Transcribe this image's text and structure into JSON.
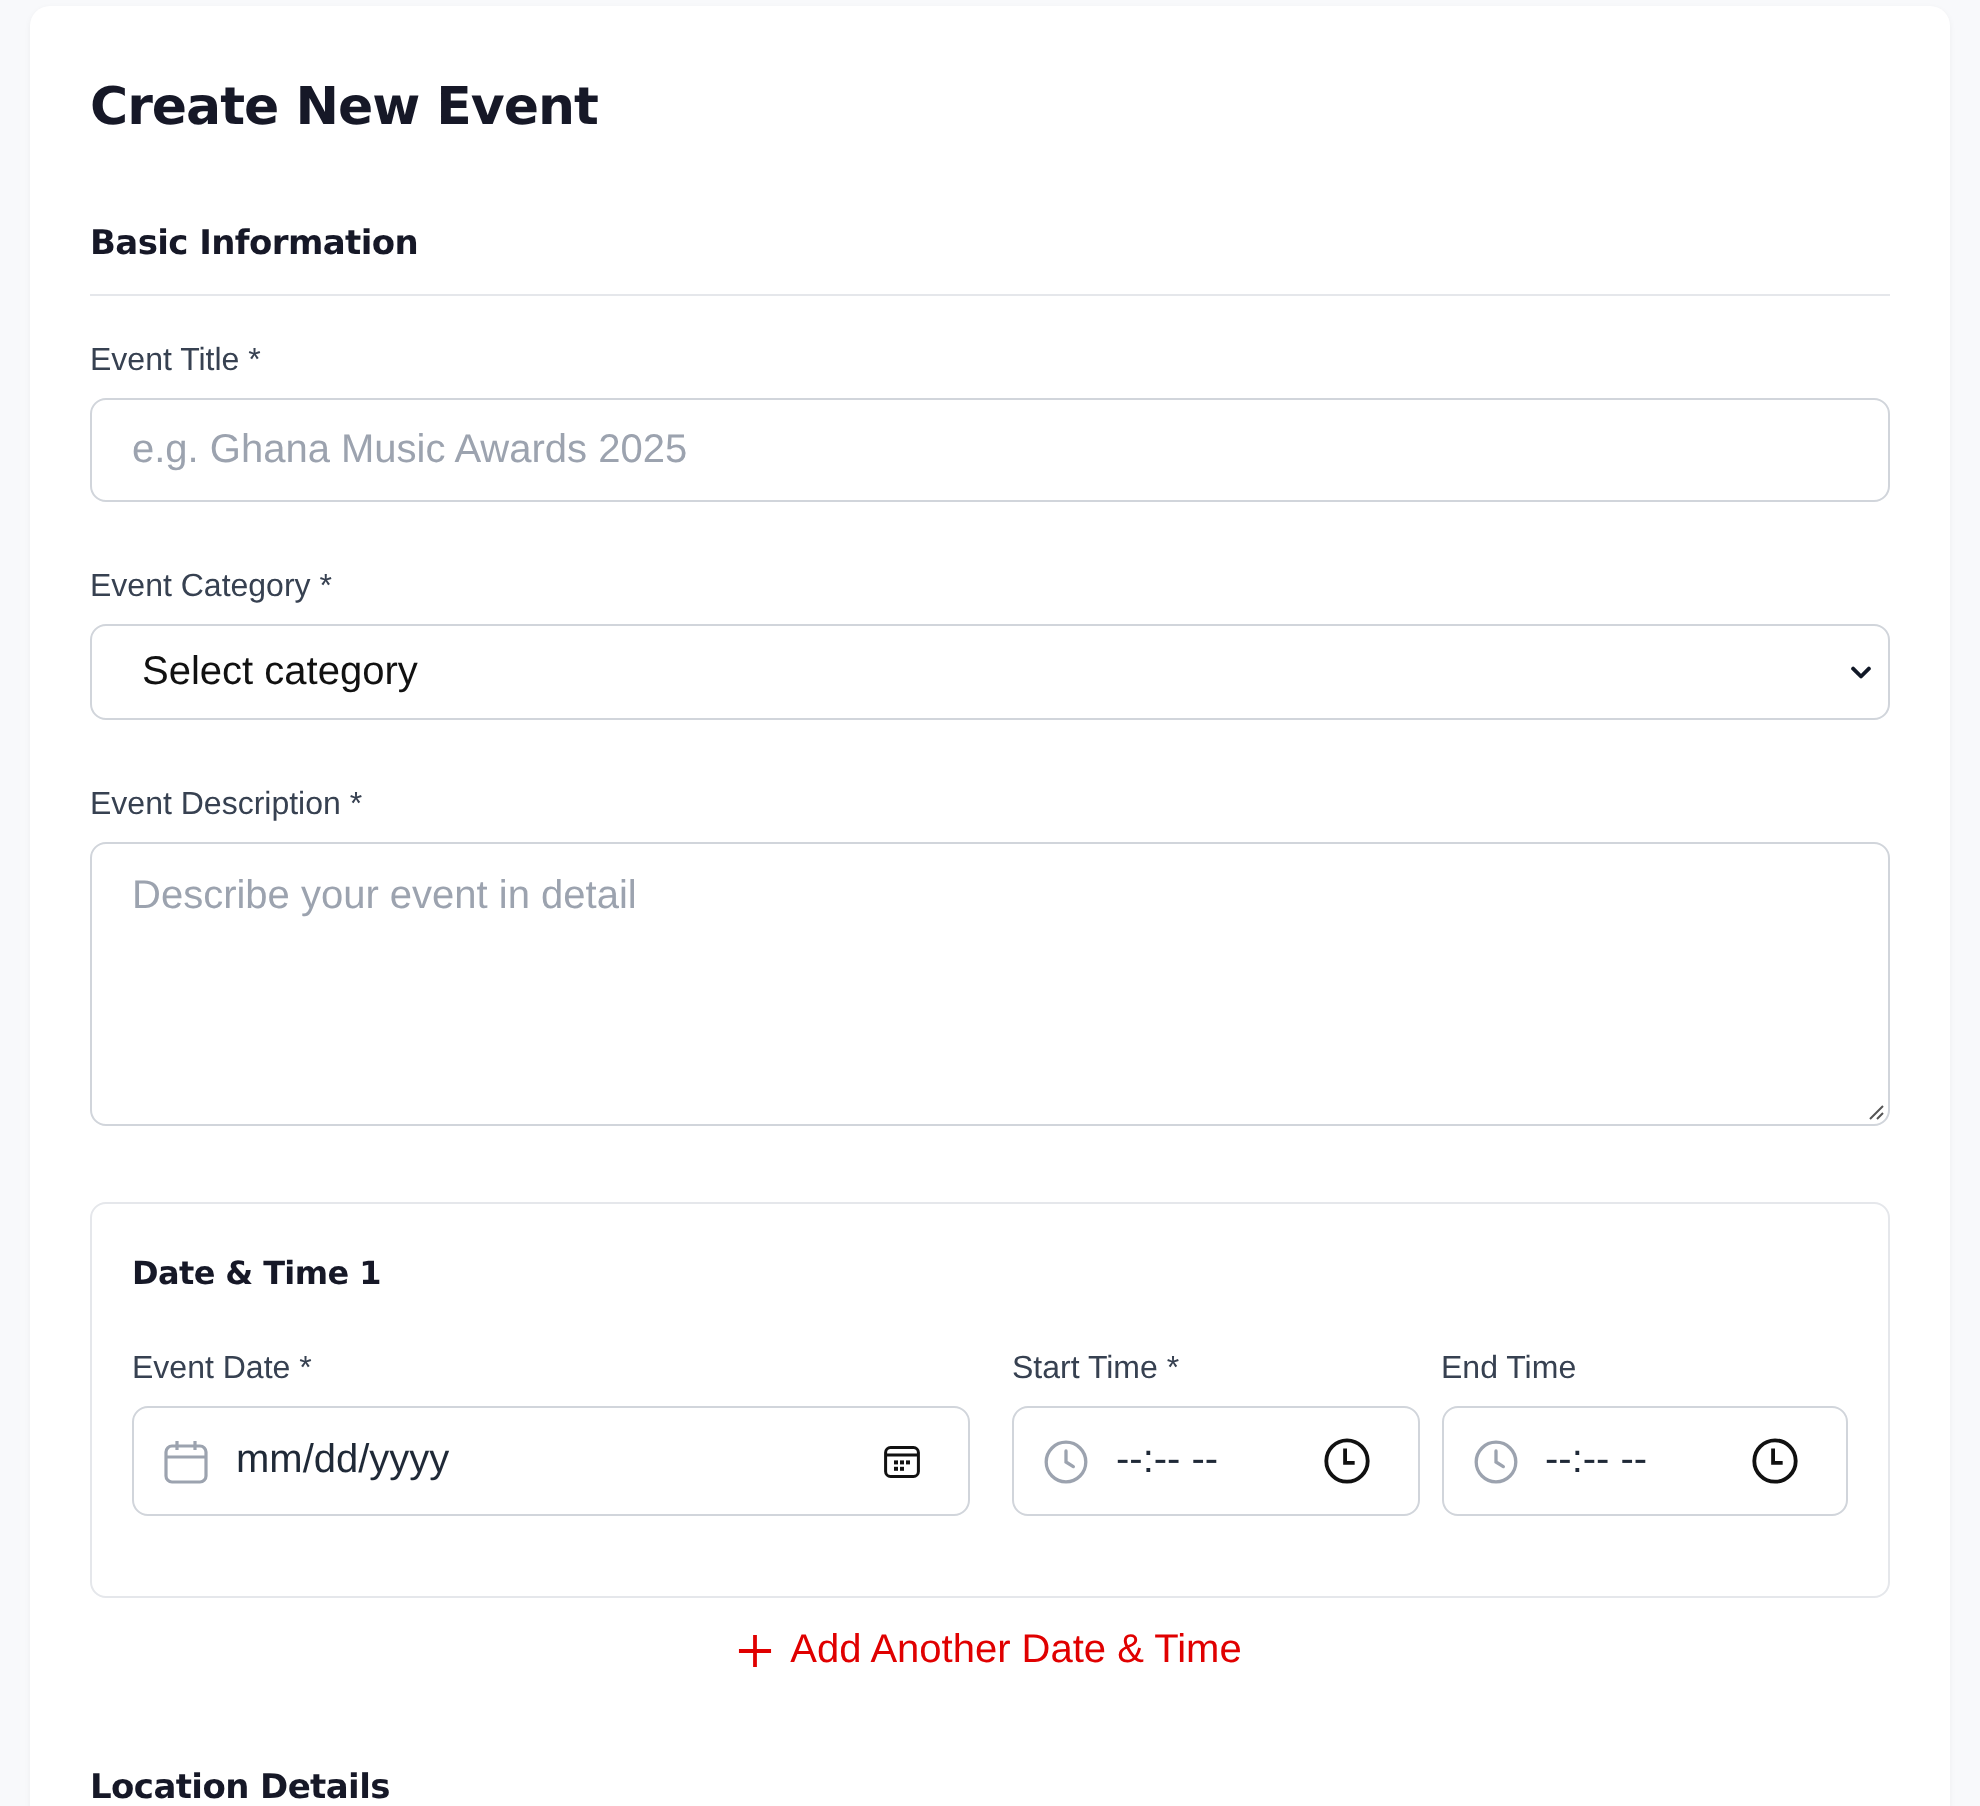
{
  "page": {
    "title": "Create New Event"
  },
  "basic_information": {
    "heading": "Basic Information",
    "fields": [
      {
        "kind": "text",
        "label": "Event Title *",
        "placeholder": "e.g. Ghana Music Awards 2025"
      },
      {
        "kind": "select",
        "label": "Event Category *",
        "value": "Select category"
      },
      {
        "kind": "textarea",
        "label": "Event Description *",
        "placeholder": "Describe your event in detail"
      }
    ]
  },
  "date_times": [
    {
      "heading": "Date & Time 1",
      "fields": [
        {
          "kind": "date",
          "label": "Event Date *",
          "placeholder": "mm/dd/yyyy"
        },
        {
          "kind": "time",
          "label": "Start Time *",
          "placeholder": "--:-- --"
        },
        {
          "kind": "time",
          "label": "End Time",
          "placeholder": "--:-- --"
        }
      ]
    }
  ],
  "add_date_button": {
    "label": "Add Another Date & Time"
  },
  "location_details": {
    "heading": "Location Details"
  }
}
